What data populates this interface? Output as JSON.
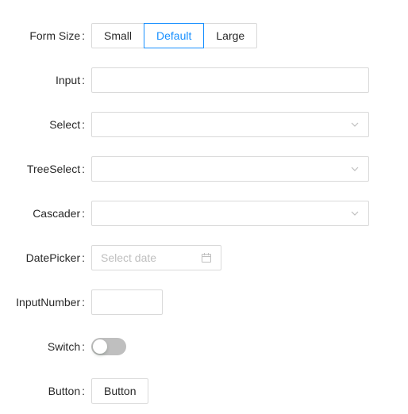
{
  "form_size": {
    "label": "Form Size",
    "options": [
      "Small",
      "Default",
      "Large"
    ],
    "selected": "Default"
  },
  "input": {
    "label": "Input",
    "value": ""
  },
  "select": {
    "label": "Select",
    "value": "",
    "icon": "chevron-down-icon"
  },
  "tree_select": {
    "label": "TreeSelect",
    "value": "",
    "icon": "chevron-down-icon"
  },
  "cascader": {
    "label": "Cascader",
    "value": "",
    "icon": "chevron-down-icon"
  },
  "date_picker": {
    "label": "DatePicker",
    "placeholder": "Select date",
    "icon": "calendar-icon"
  },
  "input_number": {
    "label": "InputNumber",
    "value": ""
  },
  "switch": {
    "label": "Switch",
    "checked": false
  },
  "button": {
    "label": "Button",
    "text": "Button"
  },
  "colors": {
    "primary": "#1890ff",
    "border": "#d9d9d9",
    "placeholder": "#bfbfbf",
    "switch_off": "#bfbfbf"
  }
}
